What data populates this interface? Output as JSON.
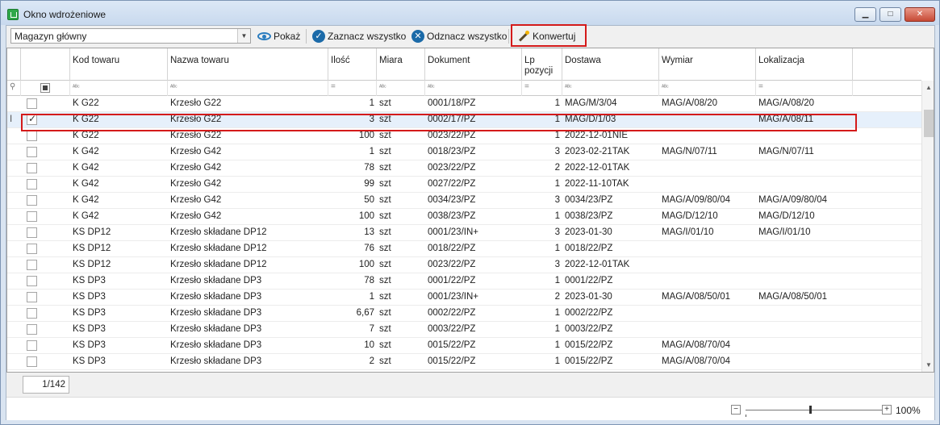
{
  "window": {
    "title": "Okno wdrożeniowe",
    "controls": {
      "minimize": "▁",
      "maximize": "□",
      "close": "✕"
    }
  },
  "toolbar": {
    "warehouse": "Magazyn główny",
    "show_label": "Pokaż",
    "select_all_label": "Zaznacz wszystko",
    "deselect_all_label": "Odznacz wszystko",
    "convert_label": "Konwertuj"
  },
  "columns": [
    "Kod towaru",
    "Nazwa towaru",
    "Ilość",
    "Miara",
    "Dokument",
    "Lp\npozycji",
    "Dostawa",
    "Wymiar",
    "Lokalizacja"
  ],
  "rows": [
    {
      "checked": false,
      "kod": "K G22",
      "nazwa": "Krzesło G22",
      "ilosc": "1",
      "miara": "szt",
      "dokument": "0001/18/PZ",
      "lp": "1",
      "dostawa": "MAG/M/3/04",
      "wymiar": "MAG/A/08/20",
      "lokalizacja": "MAG/A/08/20"
    },
    {
      "checked": true,
      "kod": "K G22",
      "nazwa": "Krzesło G22",
      "ilosc": "3",
      "miara": "szt",
      "dokument": "0002/17/PZ",
      "lp": "1",
      "dostawa": "MAG/D/1/03",
      "wymiar": "",
      "lokalizacja": "MAG/A/08/11"
    },
    {
      "checked": false,
      "kod": "K G22",
      "nazwa": "Krzesło G22",
      "ilosc": "100",
      "miara": "szt",
      "dokument": "0023/22/PZ",
      "lp": "1",
      "dostawa": "2022-12-01NIE",
      "wymiar": "",
      "lokalizacja": ""
    },
    {
      "checked": false,
      "kod": "K G42",
      "nazwa": "Krzesło G42",
      "ilosc": "1",
      "miara": "szt",
      "dokument": "0018/23/PZ",
      "lp": "3",
      "dostawa": "2023-02-21TAK",
      "wymiar": "MAG/N/07/11",
      "lokalizacja": "MAG/N/07/11"
    },
    {
      "checked": false,
      "kod": "K G42",
      "nazwa": "Krzesło G42",
      "ilosc": "78",
      "miara": "szt",
      "dokument": "0023/22/PZ",
      "lp": "2",
      "dostawa": "2022-12-01TAK",
      "wymiar": "",
      "lokalizacja": ""
    },
    {
      "checked": false,
      "kod": "K G42",
      "nazwa": "Krzesło G42",
      "ilosc": "99",
      "miara": "szt",
      "dokument": "0027/22/PZ",
      "lp": "1",
      "dostawa": "2022-11-10TAK",
      "wymiar": "",
      "lokalizacja": ""
    },
    {
      "checked": false,
      "kod": "K G42",
      "nazwa": "Krzesło G42",
      "ilosc": "50",
      "miara": "szt",
      "dokument": "0034/23/PZ",
      "lp": "3",
      "dostawa": "0034/23/PZ",
      "wymiar": "MAG/A/09/80/04",
      "lokalizacja": "MAG/A/09/80/04"
    },
    {
      "checked": false,
      "kod": "K G42",
      "nazwa": "Krzesło G42",
      "ilosc": "100",
      "miara": "szt",
      "dokument": "0038/23/PZ",
      "lp": "1",
      "dostawa": "0038/23/PZ",
      "wymiar": "MAG/D/12/10",
      "lokalizacja": "MAG/D/12/10"
    },
    {
      "checked": false,
      "kod": "KS DP12",
      "nazwa": "Krzesło składane DP12",
      "ilosc": "13",
      "miara": "szt",
      "dokument": "0001/23/IN+",
      "lp": "3",
      "dostawa": "2023-01-30",
      "wymiar": "MAG/I/01/10",
      "lokalizacja": "MAG/I/01/10"
    },
    {
      "checked": false,
      "kod": "KS DP12",
      "nazwa": "Krzesło składane DP12",
      "ilosc": "76",
      "miara": "szt",
      "dokument": "0018/22/PZ",
      "lp": "1",
      "dostawa": "0018/22/PZ",
      "wymiar": "",
      "lokalizacja": ""
    },
    {
      "checked": false,
      "kod": "KS DP12",
      "nazwa": "Krzesło składane DP12",
      "ilosc": "100",
      "miara": "szt",
      "dokument": "0023/22/PZ",
      "lp": "3",
      "dostawa": "2022-12-01TAK",
      "wymiar": "",
      "lokalizacja": ""
    },
    {
      "checked": false,
      "kod": "KS DP3",
      "nazwa": "Krzesło składane DP3",
      "ilosc": "78",
      "miara": "szt",
      "dokument": "0001/22/PZ",
      "lp": "1",
      "dostawa": "0001/22/PZ",
      "wymiar": "",
      "lokalizacja": ""
    },
    {
      "checked": false,
      "kod": "KS DP3",
      "nazwa": "Krzesło składane DP3",
      "ilosc": "1",
      "miara": "szt",
      "dokument": "0001/23/IN+",
      "lp": "2",
      "dostawa": "2023-01-30",
      "wymiar": "MAG/A/08/50/01",
      "lokalizacja": "MAG/A/08/50/01"
    },
    {
      "checked": false,
      "kod": "KS DP3",
      "nazwa": "Krzesło składane DP3",
      "ilosc": "6,67",
      "miara": "szt",
      "dokument": "0002/22/PZ",
      "lp": "1",
      "dostawa": "0002/22/PZ",
      "wymiar": "",
      "lokalizacja": ""
    },
    {
      "checked": false,
      "kod": "KS DP3",
      "nazwa": "Krzesło składane DP3",
      "ilosc": "7",
      "miara": "szt",
      "dokument": "0003/22/PZ",
      "lp": "1",
      "dostawa": "0003/22/PZ",
      "wymiar": "",
      "lokalizacja": ""
    },
    {
      "checked": false,
      "kod": "KS DP3",
      "nazwa": "Krzesło składane DP3",
      "ilosc": "10",
      "miara": "szt",
      "dokument": "0015/22/PZ",
      "lp": "1",
      "dostawa": "0015/22/PZ",
      "wymiar": "MAG/A/08/70/04",
      "lokalizacja": ""
    },
    {
      "checked": false,
      "kod": "KS DP3",
      "nazwa": "Krzesło składane DP3",
      "ilosc": "2",
      "miara": "szt",
      "dokument": "0015/22/PZ",
      "lp": "1",
      "dostawa": "0015/22/PZ",
      "wymiar": "MAG/A/08/70/04",
      "lokalizacja": ""
    }
  ],
  "pager": {
    "position": "1/142"
  },
  "zoom": {
    "minus": "−",
    "plus": "+",
    "level": "100%"
  },
  "colors": {
    "highlight": "#d41a1a",
    "accent": "#1b6aa8"
  }
}
